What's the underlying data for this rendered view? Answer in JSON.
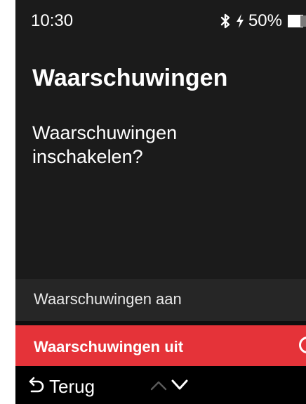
{
  "status": {
    "time": "10:30",
    "battery_percent": "50%",
    "battery_level": 0.5,
    "icons": [
      "bluetooth-icon",
      "charging-icon",
      "battery-icon"
    ]
  },
  "screen": {
    "title": "Waarschuwingen",
    "question": "Waarschuwingen inschakelen?"
  },
  "options": {
    "on_label": "Waarschuwingen aan",
    "off_label": "Waarschuwingen uit",
    "selected": "off"
  },
  "nav": {
    "back_label": "Terug",
    "icons": [
      "back-arrow-icon",
      "up-arrow-icon",
      "down-arrow-icon"
    ]
  },
  "colors": {
    "background": "#1b1b1b",
    "accent": "#e53339",
    "option_bg": "#262626",
    "bottom_bar": "#000000"
  }
}
